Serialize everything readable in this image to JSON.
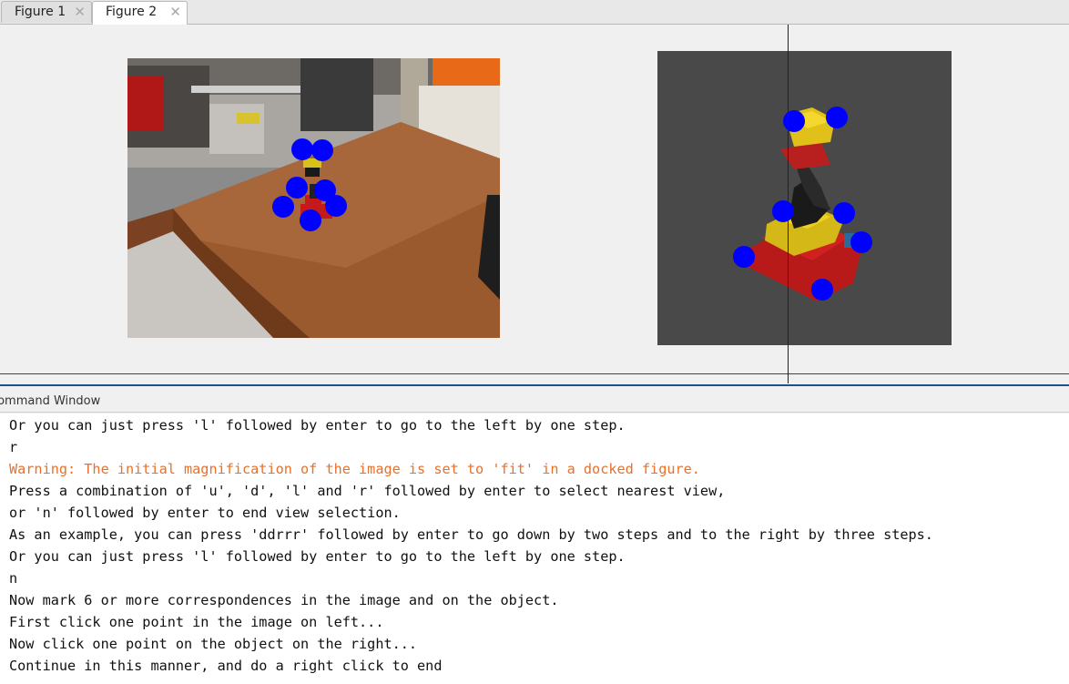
{
  "tabs": [
    {
      "label": "Figure 1",
      "active": false
    },
    {
      "label": "Figure 2",
      "active": true
    }
  ],
  "icons": {
    "tab_close": "close-icon"
  },
  "figure": {
    "left_image": {
      "description_marker_color": "#0000ff"
    },
    "right_image": {
      "background": "#494949",
      "marker_color": "#0000ff"
    }
  },
  "command_window": {
    "title": "Command Window",
    "lines": [
      {
        "text": "Or you can just press 'l' followed by enter to go to the left by one step.",
        "type": "normal"
      },
      {
        "text": "r",
        "type": "normal"
      },
      {
        "text": "Warning: The initial magnification of the image is set to 'fit' in a docked figure.",
        "type": "warning"
      },
      {
        "text": "Press a combination of 'u', 'd', 'l' and 'r' followed by enter to select nearest view,",
        "type": "normal"
      },
      {
        "text": "or 'n' followed by enter to end view selection.",
        "type": "normal"
      },
      {
        "text": "As an example, you can press 'ddrrr' followed by enter to go down by two steps and to the right by three steps.",
        "type": "normal"
      },
      {
        "text": "Or you can just press 'l' followed by enter to go to the left by one step.",
        "type": "normal"
      },
      {
        "text": "n",
        "type": "normal"
      },
      {
        "text": "Now mark 6 or more correspondences in the image and on the object.",
        "type": "normal"
      },
      {
        "text": "First click one point in the image on left...",
        "type": "normal"
      },
      {
        "text": "Now click one point on the object on the right...",
        "type": "normal"
      },
      {
        "text": "Continue in this manner, and do a right click to end",
        "type": "normal"
      }
    ],
    "warning_color": "#e8702a"
  }
}
